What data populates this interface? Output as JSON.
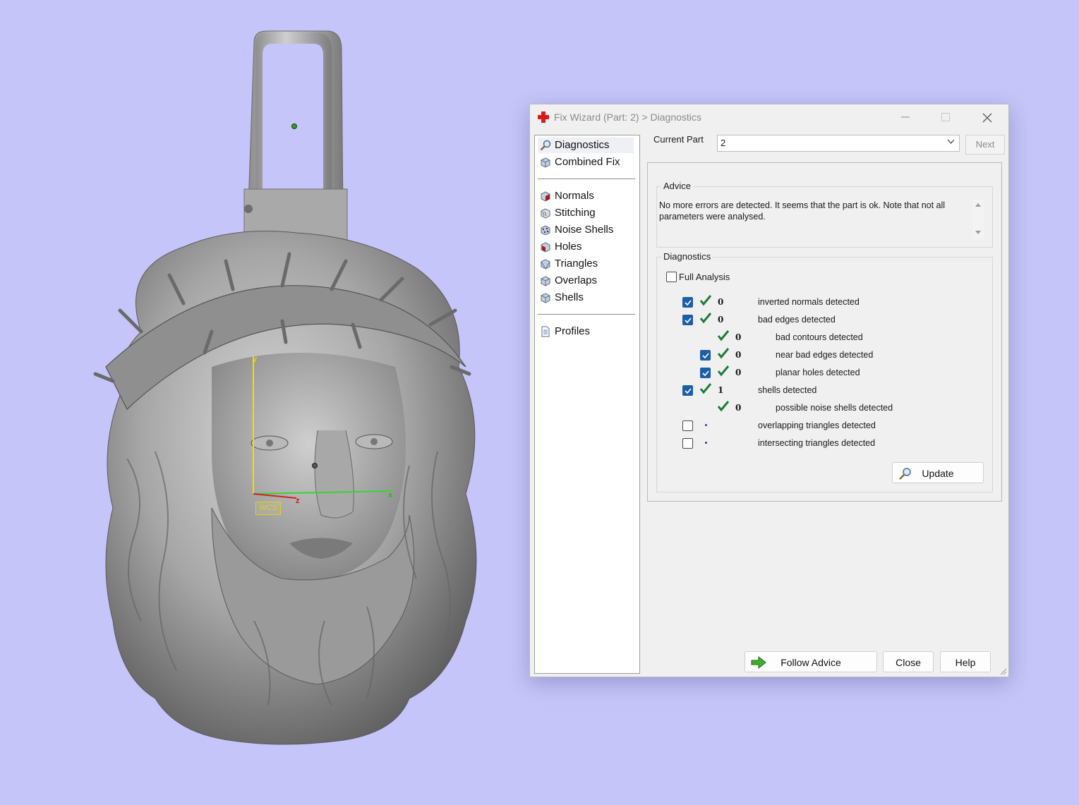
{
  "viewport": {
    "wcs_label": "WCS",
    "axis_x": "x",
    "axis_y": "y",
    "axis_z": "z"
  },
  "dialog": {
    "title": "Fix Wizard (Part: 2) > Diagnostics",
    "nav": [
      {
        "label": "Diagnostics",
        "icon": "magnifier-icon"
      },
      {
        "label": "Combined Fix",
        "icon": "cube-icon"
      },
      {
        "label": "Normals",
        "icon": "normals-cube-icon"
      },
      {
        "label": "Stitching",
        "icon": "stitching-cube-icon"
      },
      {
        "label": "Noise Shells",
        "icon": "noise-shells-icon"
      },
      {
        "label": "Holes",
        "icon": "holes-cube-icon"
      },
      {
        "label": "Triangles",
        "icon": "triangles-cube-icon"
      },
      {
        "label": "Overlaps",
        "icon": "overlaps-cube-icon"
      },
      {
        "label": "Shells",
        "icon": "shells-cube-icon"
      },
      {
        "label": "Profiles",
        "icon": "profiles-document-icon"
      }
    ],
    "current_part_label": "Current Part",
    "current_part_value": "2",
    "next_label": "Next",
    "advice_title": "Advice",
    "advice_text": "No more errors are detected. It seems that the part is ok. Note that not all parameters were analysed.",
    "diagnostics_title": "Diagnostics",
    "full_analysis_label": "Full Analysis",
    "full_analysis_checked": false,
    "rows": [
      {
        "checked": true,
        "status": "ok",
        "count": "0",
        "label": "inverted normals detected"
      },
      {
        "checked": true,
        "status": "ok",
        "count": "0",
        "label": "bad edges detected"
      },
      {
        "checked": null,
        "status": "ok",
        "count": "0",
        "label": "bad contours detected"
      },
      {
        "checked": true,
        "status": "ok",
        "count": "0",
        "label": "near bad edges detected"
      },
      {
        "checked": true,
        "status": "ok",
        "count": "0",
        "label": "planar holes detected"
      },
      {
        "checked": true,
        "status": "ok",
        "count": "1",
        "label": "shells detected"
      },
      {
        "checked": null,
        "status": "ok",
        "count": "0",
        "label": "possible noise shells detected"
      },
      {
        "checked": false,
        "status": "dot",
        "count": "",
        "label": "overlapping triangles detected"
      },
      {
        "checked": false,
        "status": "dot",
        "count": "",
        "label": "intersecting triangles detected"
      }
    ],
    "update_label": "Update",
    "follow_advice_label": "Follow Advice",
    "close_label": "Close",
    "help_label": "Help"
  },
  "colors": {
    "background": "#c6c5f9",
    "model": "#9d9d9d",
    "checkbox_on": "#1d5ea9",
    "tick_green": "#1e7a38"
  }
}
